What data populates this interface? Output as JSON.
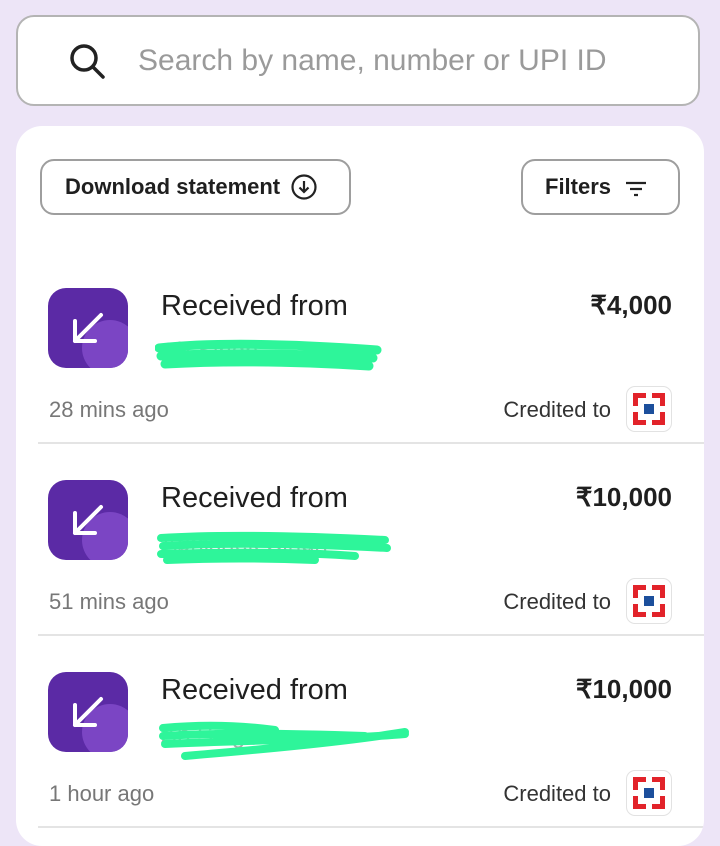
{
  "search": {
    "placeholder": "Search by name, number or UPI ID",
    "icon": "search-icon"
  },
  "toolbar": {
    "download_label": "Download statement",
    "filters_label": "Filters"
  },
  "colors": {
    "accent": "#5b2aa5",
    "bank_red": "#e2232a",
    "bank_blue": "#1c4f9c",
    "redaction": "#2ef59a"
  },
  "transactions": [
    {
      "title": "Received from",
      "name_visible": "Ab         Singh",
      "amount": "₹4,000",
      "time": "28 mins ago",
      "credited_label": "Credited to"
    },
    {
      "title": "Received from",
      "name_visible": "Abhishek Singh",
      "amount": "₹10,000",
      "time": "51 mins ago",
      "credited_label": "Credited to"
    },
    {
      "title": "Received from",
      "name_visible": "Ab          Singh",
      "amount": "₹10,000",
      "time": "1 hour ago",
      "credited_label": "Credited to"
    }
  ]
}
